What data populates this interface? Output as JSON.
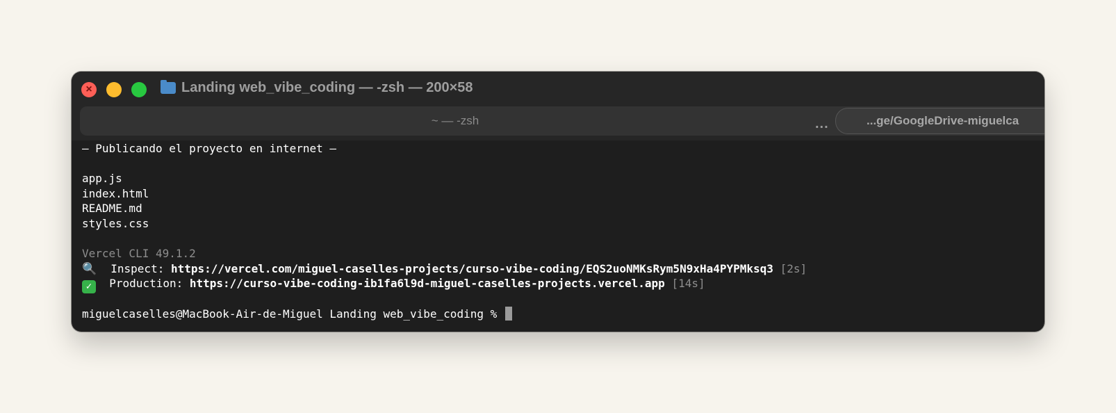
{
  "window": {
    "title": "Landing web_vibe_coding — -zsh — 200×58"
  },
  "tabs": {
    "active_label": "~ — -zsh",
    "more_label": "...",
    "second_label": "...ge/GoogleDrive-miguelca"
  },
  "terminal": {
    "header": "— Publicando el proyecto en internet —",
    "files": [
      "app.js",
      "index.html",
      "README.md",
      "styles.css"
    ],
    "cli_version": "Vercel CLI 49.1.2",
    "inspect": {
      "icon": "magnifier-icon",
      "label": "Inspect: ",
      "url": "https://vercel.com/miguel-caselles-projects/curso-vibe-coding/EQS2uoNMKsRym5N9xHa4PYPMksq3",
      "time": "[2s]"
    },
    "production": {
      "icon": "check-icon",
      "label": "Production: ",
      "url": "https://curso-vibe-coding-ib1fa6l9d-miguel-caselles-projects.vercel.app",
      "time": "[14s]"
    },
    "prompt": "miguelcaselles@MacBook-Air-de-Miguel Landing web_vibe_coding % "
  },
  "colors": {
    "background": "#f7f4ed",
    "terminal_bg": "#1e1e1e",
    "close": "#ff5f57",
    "minimize": "#febc2e",
    "maximize": "#28c840",
    "folder": "#4a8bc9"
  }
}
